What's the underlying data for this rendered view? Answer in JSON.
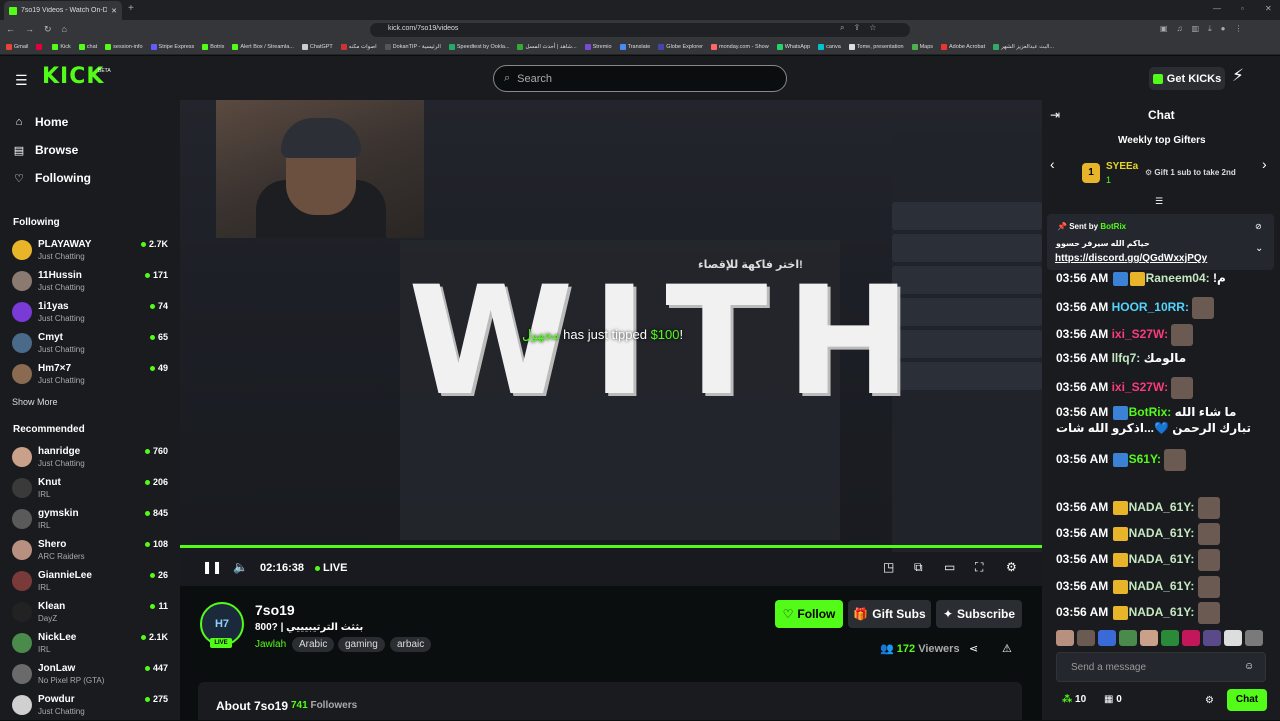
{
  "browser": {
    "tab_title": "7so19 Videos - Watch On-De...",
    "url": "kick.com/7so19/videos",
    "bookmarks": [
      "Gmail",
      "",
      "Kick",
      "chat",
      "session-info",
      "Stripe Express",
      "Botrix",
      "Alert Box / Streamla...",
      "ChatGPT",
      "اصوات مكنه",
      "DokanTIP - الرئيسية",
      "Speedtest by Ookla...",
      "شاهد | أحدث المسل...",
      "Stremio",
      "Translate",
      "Globe Explorer",
      "monday.com - Show",
      "WhatsApp",
      "canva",
      "Tome, presentation",
      "Maps",
      "Adobe Acrobat",
      "البث عبدالعزيز الشهر..."
    ]
  },
  "header": {
    "logo": "KICK",
    "beta": "BETA",
    "search_placeholder": "Search",
    "get_kicks": "Get KICKs"
  },
  "nav": [
    {
      "label": "Home",
      "icon": "home-icon"
    },
    {
      "label": "Browse",
      "icon": "browse-icon"
    },
    {
      "label": "Following",
      "icon": "heart-icon"
    }
  ],
  "sidebar": {
    "following_heading": "Following",
    "following": [
      {
        "name": "PLAYAWAY",
        "category": "Just Chatting",
        "viewers": "2.7K",
        "color": "#e8b52a"
      },
      {
        "name": "11Hussin",
        "category": "Just Chatting",
        "viewers": "171",
        "color": "#8a7a70"
      },
      {
        "name": "1i1yas",
        "category": "Just Chatting",
        "viewers": "74",
        "color": "#7a3ad6"
      },
      {
        "name": "Cmyt",
        "category": "Just Chatting",
        "viewers": "65",
        "color": "#4a6a8a"
      },
      {
        "name": "Hm7×7",
        "category": "Just Chatting",
        "viewers": "49",
        "color": "#8a6a50"
      }
    ],
    "show_more": "Show More",
    "recommended_heading": "Recommended",
    "recommended": [
      {
        "name": "hanridge",
        "category": "Just Chatting",
        "viewers": "760",
        "color": "#c9a08a"
      },
      {
        "name": "Knut",
        "category": "IRL",
        "viewers": "206",
        "color": "#3a3a3a"
      },
      {
        "name": "gymskin",
        "category": "IRL",
        "viewers": "845",
        "color": "#5a5a5a"
      },
      {
        "name": "Shero",
        "category": "ARC Raiders",
        "viewers": "108",
        "color": "#b89080"
      },
      {
        "name": "GiannieLee",
        "category": "IRL",
        "viewers": "26",
        "color": "#7a3a3a"
      },
      {
        "name": "Klean",
        "category": "DayZ",
        "viewers": "11",
        "color": "#222222"
      },
      {
        "name": "NickLee",
        "category": "IRL",
        "viewers": "2.1K",
        "color": "#4a8a4a"
      },
      {
        "name": "JonLaw",
        "category": "No Pixel RP (GTA)",
        "viewers": "447",
        "color": "#6a6a6a"
      },
      {
        "name": "Powdur",
        "category": "Just Chatting",
        "viewers": "275",
        "color": "#d0d0d0"
      }
    ]
  },
  "video": {
    "overlay_text": "WITH",
    "arabic_title": "اختر فاكهة للإقصاء!",
    "tip_user": "مجهول",
    "tip_text": " has just tipped ",
    "tip_amount": "$100",
    "tip_end": "!",
    "time": "02:16:38",
    "live_label": "LIVE",
    "progress_percent": 100
  },
  "channel": {
    "name": "7so19",
    "title": "800? | بثثث الترتيبيييي",
    "category": "Jawlah",
    "tags": [
      "Arabic",
      "gaming",
      "arbaic"
    ],
    "live_badge": "LIVE",
    "follow": "Follow",
    "gift_subs": "Gift Subs",
    "subscribe": "Subscribe",
    "viewers": "172",
    "viewers_label": "Viewers",
    "about": "About 7so19",
    "followers": "741",
    "followers_label": "Followers"
  },
  "chat": {
    "title": "Chat",
    "weekly_top_gifters": "Weekly top Gifters",
    "top_gifter_rank": "1",
    "top_gifter_name": "SYEEa",
    "top_gifter_count": "1",
    "gift_prompt": "Gift 1 sub to take 2nd",
    "pinned_sent_by": "Sent by",
    "pinned_user": "BotRix",
    "pinned_arabic": "حياكم الله سيرفر حسوو",
    "pinned_link": "https://discord.gg/QGdWxxjPQy",
    "messages": [
      {
        "time": "03:56 AM",
        "user": "Raneem04:",
        "text": " !م",
        "color": "#c5e8c0"
      },
      {
        "time": "03:56 AM",
        "user": "HOOR_10RR:",
        "text": "",
        "color": "#53d3fc"
      },
      {
        "time": "03:56 AM",
        "user": "ixi_S27W:",
        "text": "",
        "color": "#fc3b7b"
      },
      {
        "time": "03:56 AM",
        "user": "llfq7:",
        "text": " مالومك",
        "color": "#c5e8c0"
      },
      {
        "time": "03:56 AM",
        "user": "ixi_S27W:",
        "text": "",
        "color": "#fc3b7b"
      },
      {
        "time": "03:56 AM",
        "user": "BotRix:",
        "text": " ما شاء الله تبارك الرحمن 💙...اذكرو الله شات",
        "color": "#53fc18"
      },
      {
        "time": "03:56 AM",
        "user": "S61Y:",
        "text": "",
        "color": "#53fc18"
      },
      {
        "time": "03:56 AM",
        "user": "NADA_61Y:",
        "text": "",
        "color": "#c5e8c0"
      },
      {
        "time": "03:56 AM",
        "user": "NADA_61Y:",
        "text": "",
        "color": "#c5e8c0"
      },
      {
        "time": "03:56 AM",
        "user": "NADA_61Y:",
        "text": "",
        "color": "#c5e8c0"
      },
      {
        "time": "03:56 AM",
        "user": "NADA_61Y:",
        "text": "",
        "color": "#c5e8c0"
      },
      {
        "time": "03:56 AM",
        "user": "NADA_61Y:",
        "text": "",
        "color": "#c5e8c0"
      }
    ],
    "send_placeholder": "Send a message",
    "kicks_count": "10",
    "subs_count": "0",
    "chat_button": "Chat"
  },
  "colors": {
    "accent": "#53fc18",
    "bg": "#0b0e0f",
    "panel": "#191b1f"
  }
}
